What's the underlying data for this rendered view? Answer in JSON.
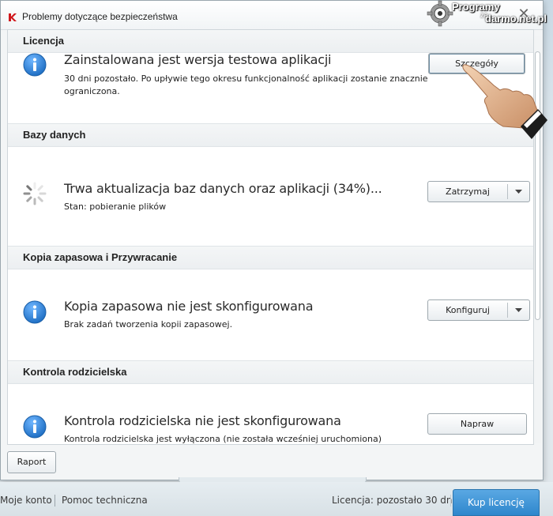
{
  "window": {
    "title": "Problemy dotyczące bezpieczeństwa"
  },
  "watermark": {
    "line1": "Programy",
    "line2": "za",
    "line3": "darmo.net.pl"
  },
  "sections": [
    {
      "header": "Licencja",
      "icon": "info-icon",
      "title": "Zainstalowana jest wersja testowa aplikacji",
      "description": "30 dni pozostało. Po upływie tego okresu funkcjonalność aplikacji zostanie znacznie ograniczona.",
      "button": "Szczegóły"
    },
    {
      "header": "Bazy danych",
      "icon": "loading-spinner-icon",
      "title": "Trwa aktualizacja baz danych oraz aplikacji (34%)...",
      "description": "Stan: pobieranie plików",
      "button": "Zatrzymaj",
      "progress_percent": 34
    },
    {
      "header": "Kopia zapasowa i Przywracanie",
      "icon": "info-icon",
      "title": "Kopia zapasowa nie jest skonfigurowana",
      "description": "Brak zadań tworzenia kopii zapasowej.",
      "button": "Konfiguruj"
    },
    {
      "header": "Kontrola rodzicielska",
      "icon": "info-icon",
      "title": "Kontrola rodzicielska nie jest skonfigurowana",
      "description": "Kontrola rodzicielska jest wyłączona (nie została wcześniej uruchomiona)",
      "button": "Napraw"
    }
  ],
  "bottom": {
    "report_button": "Raport"
  },
  "footer": {
    "my_account": "Moje konto",
    "support": "Pomoc techniczna",
    "license_status": "Licencja: pozostało 30 dni",
    "buy_button": "Kup licencję"
  },
  "colors": {
    "accent_blue": "#2e86cc",
    "info_icon_blue": "#2f7fd0"
  }
}
